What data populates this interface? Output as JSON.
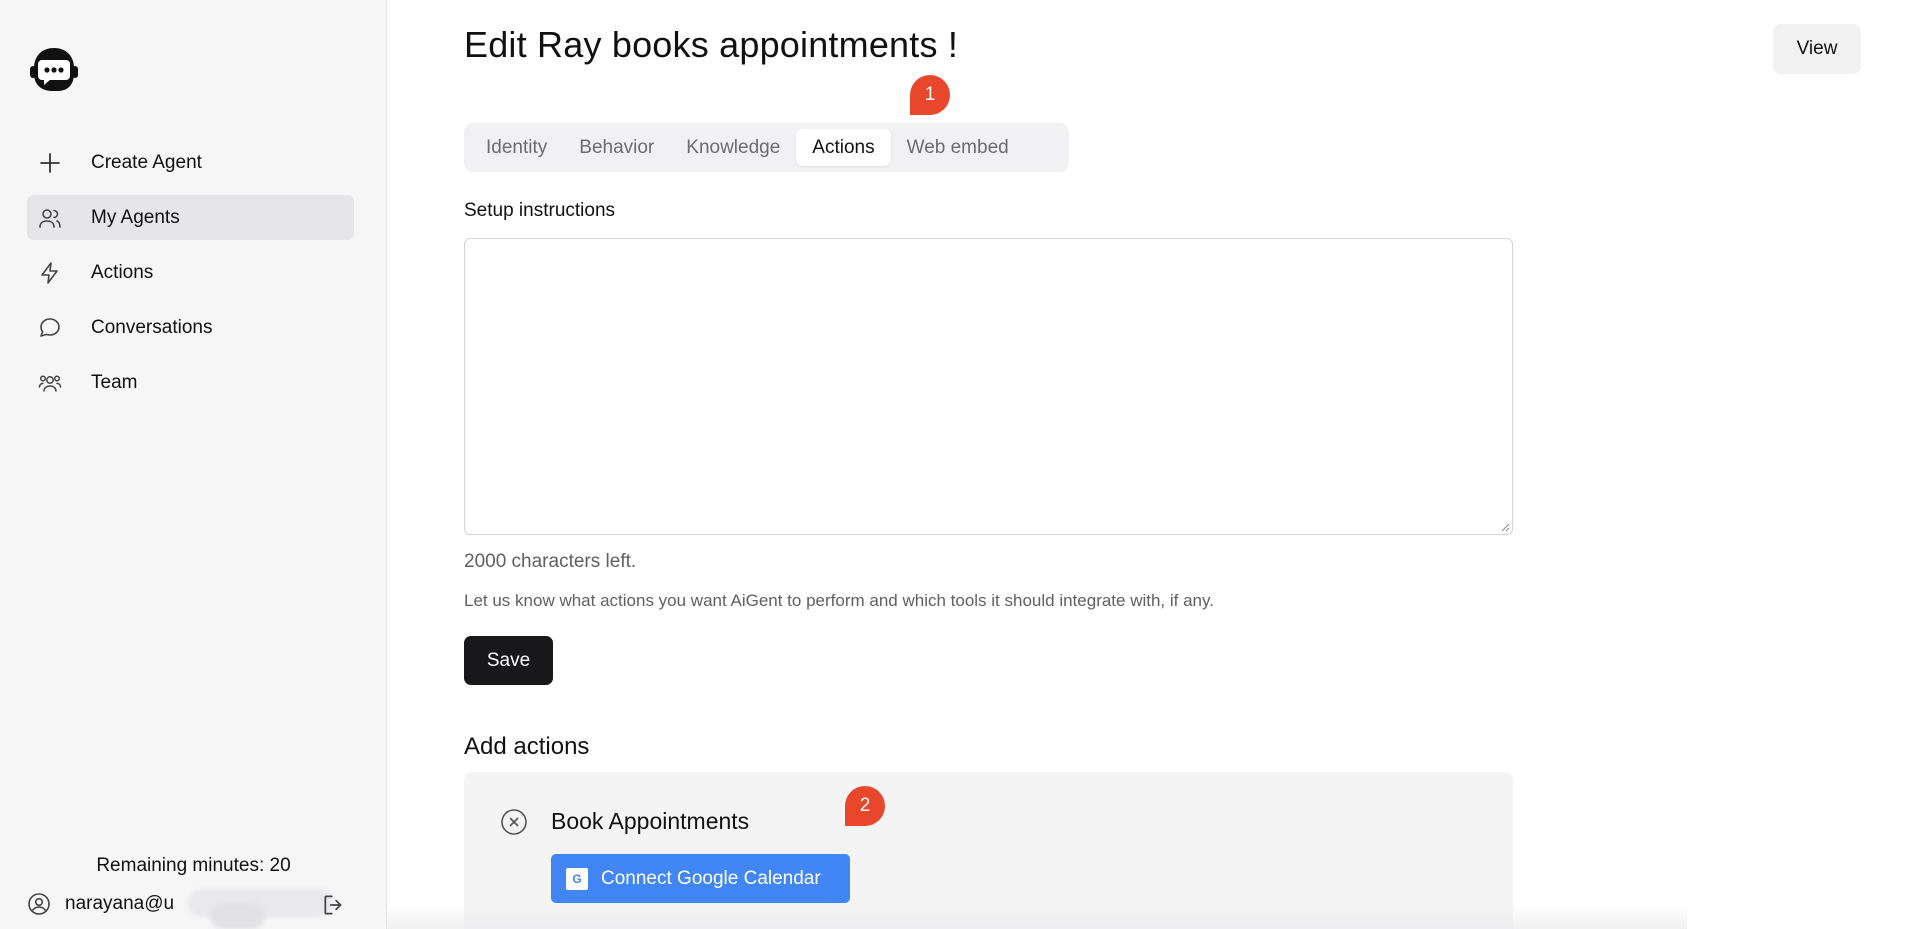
{
  "sidebar": {
    "items": [
      {
        "label": "Create Agent",
        "icon": "plus-icon"
      },
      {
        "label": "My Agents",
        "icon": "users-icon",
        "active": true
      },
      {
        "label": "Actions",
        "icon": "bolt-icon"
      },
      {
        "label": "Conversations",
        "icon": "chat-bubble-icon"
      },
      {
        "label": "Team",
        "icon": "team-icon"
      }
    ],
    "remaining": "Remaining minutes: 20",
    "user_email": "narayana@u"
  },
  "header": {
    "title": "Edit Ray books appointments !",
    "view_label": "View"
  },
  "tabs": [
    {
      "label": "Identity"
    },
    {
      "label": "Behavior"
    },
    {
      "label": "Knowledge"
    },
    {
      "label": "Actions",
      "active": true
    },
    {
      "label": "Web embed"
    }
  ],
  "badges": {
    "one": "1",
    "two": "2"
  },
  "setup": {
    "label": "Setup instructions",
    "value": "",
    "chars_left": "2000 characters left.",
    "help": "Let us know what actions you want AiGent to perform and which tools it should integrate with, if any.",
    "save_label": "Save"
  },
  "add_actions": {
    "title": "Add actions",
    "action_name": "Book Appointments",
    "connect_label": "Connect Google Calendar",
    "google_glyph": "G"
  },
  "colors": {
    "accent_blue": "#4285f4",
    "badge_red": "#e8472c",
    "save_dark": "#18181b"
  }
}
